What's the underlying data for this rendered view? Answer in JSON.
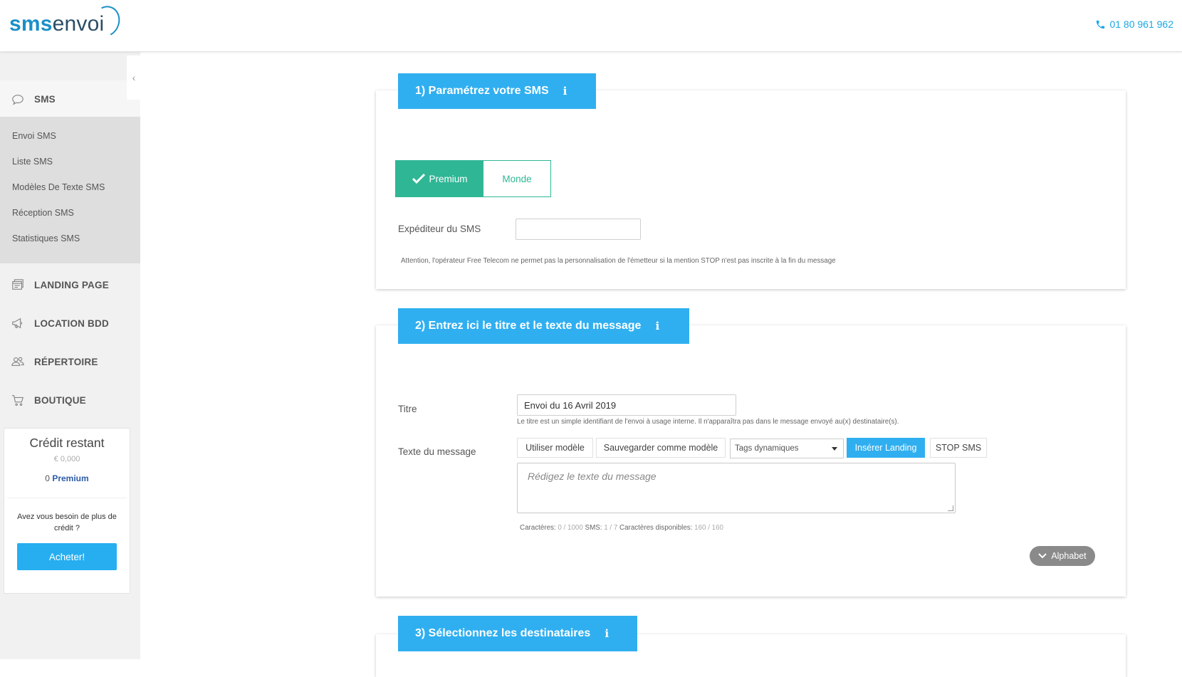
{
  "header": {
    "logo_sms": "sms",
    "logo_envoi": "envoi",
    "phone": "01 80 961 962"
  },
  "sidebar": {
    "sms_label": "SMS",
    "sub_items": [
      "Envoi SMS",
      "Liste SMS",
      "Modèles De Texte SMS",
      "Réception SMS",
      "Statistiques SMS"
    ],
    "main_items": [
      {
        "label": "LANDING PAGE",
        "icon": "landing-page-icon"
      },
      {
        "label": "LOCATION BDD",
        "icon": "megaphone-icon"
      },
      {
        "label": "RÉPERTOIRE",
        "icon": "contacts-icon"
      },
      {
        "label": "BOUTIQUE",
        "icon": "cart-icon"
      }
    ],
    "credit": {
      "title": "Crédit restant",
      "value": "€ 0,000",
      "premium_count": "0",
      "premium_label": "Premium",
      "question": "Avez vous besoin de plus de crédit ?",
      "buy_label": "Acheter!"
    }
  },
  "section1": {
    "title": "1) Paramétrez votre SMS",
    "info": "i",
    "premium_label": "Premium",
    "monde_label": "Monde",
    "sender_label": "Expéditeur du SMS",
    "sender_value": "",
    "warning": "Attention, l'opérateur Free Telecom ne permet pas la personnalisation de l'émetteur si la mention STOP n'est pas inscrite à la fin du message"
  },
  "section2": {
    "title": "2) Entrez ici le titre et le texte du message",
    "info": "i",
    "titre_label": "Titre",
    "titre_value": "Envoi du  16 Avril 2019",
    "titre_hint": "Le titre est un simple identifiant de l'envoi à usage interne. Il n'apparaîtra pas dans le message envoyé au(x) destinataire(s).",
    "message_label": "Texte du message",
    "toolbar": {
      "use_template": "Utiliser modèle",
      "save_template": "Sauvegarder comme modèle",
      "tags_select": "Tags dynamiques",
      "insert_landing": "Insérer Landing",
      "stop_sms": "STOP SMS"
    },
    "message_placeholder": "Rédigez le texte du message",
    "counter": {
      "chars_label": "Caractères:",
      "chars_value": "0 / 1000",
      "sms_label": "SMS:",
      "sms_value": "1 / 7",
      "available_label": "Caractères disponibles:",
      "available_value": "160 / 160"
    },
    "alphabet_label": "Alphabet"
  },
  "section3": {
    "title": "3) Sélectionnez les destinataires",
    "info": "i"
  },
  "colors": {
    "accent": "#30aff0",
    "green": "#2fb695",
    "sidebar_bg": "#f1f1f1"
  }
}
